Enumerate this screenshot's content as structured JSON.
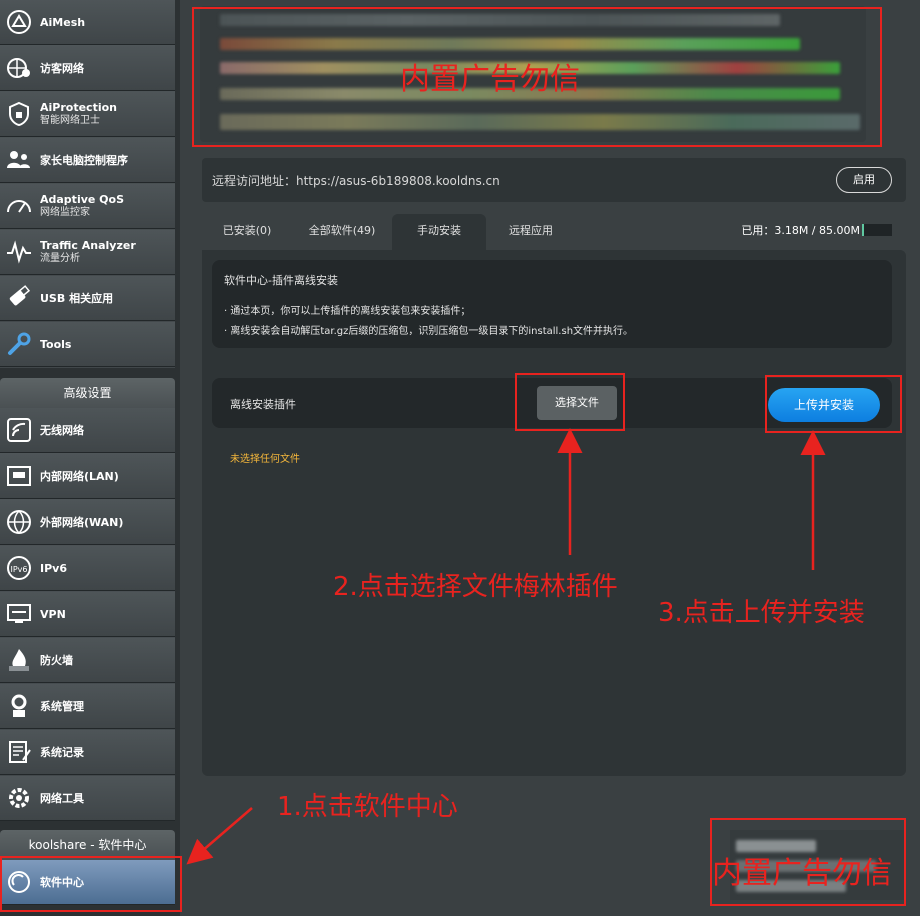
{
  "sidebar": {
    "top_items": [
      {
        "label": "AiMesh",
        "sub": "",
        "icon": "aimesh-icon"
      },
      {
        "label": "访客网络",
        "sub": "",
        "icon": "guest-network-icon"
      },
      {
        "label": "AiProtection",
        "sub": "智能网络卫士",
        "icon": "aiprotection-icon"
      },
      {
        "label": "家长电脑控制程序",
        "sub": "",
        "icon": "parental-control-icon"
      },
      {
        "label": "Adaptive QoS",
        "sub": "网络监控家",
        "icon": "qos-gauge-icon"
      },
      {
        "label": "Traffic Analyzer",
        "sub": "流量分析",
        "icon": "traffic-analyzer-icon"
      },
      {
        "label": "USB 相关应用",
        "sub": "",
        "icon": "usb-icon"
      },
      {
        "label": "Tools",
        "sub": "",
        "icon": "tools-icon"
      }
    ],
    "advanced_header": "高级设置",
    "advanced_items": [
      {
        "label": "无线网络",
        "icon": "wireless-icon"
      },
      {
        "label": "内部网络(LAN)",
        "icon": "lan-icon"
      },
      {
        "label": "外部网络(WAN)",
        "icon": "wan-globe-icon"
      },
      {
        "label": "IPv6",
        "icon": "ipv6-icon"
      },
      {
        "label": "VPN",
        "icon": "vpn-icon"
      },
      {
        "label": "防火墙",
        "icon": "firewall-icon"
      },
      {
        "label": "系统管理",
        "icon": "system-admin-icon"
      },
      {
        "label": "系统记录",
        "icon": "system-log-icon"
      },
      {
        "label": "网络工具",
        "icon": "network-tools-icon"
      }
    ],
    "koolshare_header": "koolshare - 软件中心",
    "active_item": {
      "label": "软件中心",
      "icon": "software-center-icon"
    }
  },
  "ad_text": "内置广告勿信",
  "remote": {
    "label": "远程访问地址：https://asus-6b189808.kooldns.cn",
    "enable_button": "启用"
  },
  "tabs": [
    {
      "label": "已安装(0)"
    },
    {
      "label": "全部软件(49)"
    },
    {
      "label": "手动安装"
    },
    {
      "label": "远程应用"
    }
  ],
  "usage": "已用：3.18M / 85.00M",
  "info": {
    "title": "软件中心-插件离线安装",
    "lines": [
      "· 通过本页，你可以上传插件的离线安装包来安装插件；",
      "· 离线安装会自动解压tar.gz后缀的压缩包，识别压缩包一级目录下的install.sh文件并执行。"
    ]
  },
  "upload": {
    "label": "离线安装插件",
    "choose_button": "选择文件",
    "install_button": "上传并安装",
    "no_file": "未选择任何文件"
  },
  "annotations": {
    "step1": "1.点击软件中心",
    "step2": "2.点击选择文件梅林插件",
    "step3": "3.点击上传并安装"
  },
  "colors": {
    "annotation_red": "#e8231f",
    "install_blue": "#1a8fe9",
    "no_file_orange": "#f5b73b"
  }
}
